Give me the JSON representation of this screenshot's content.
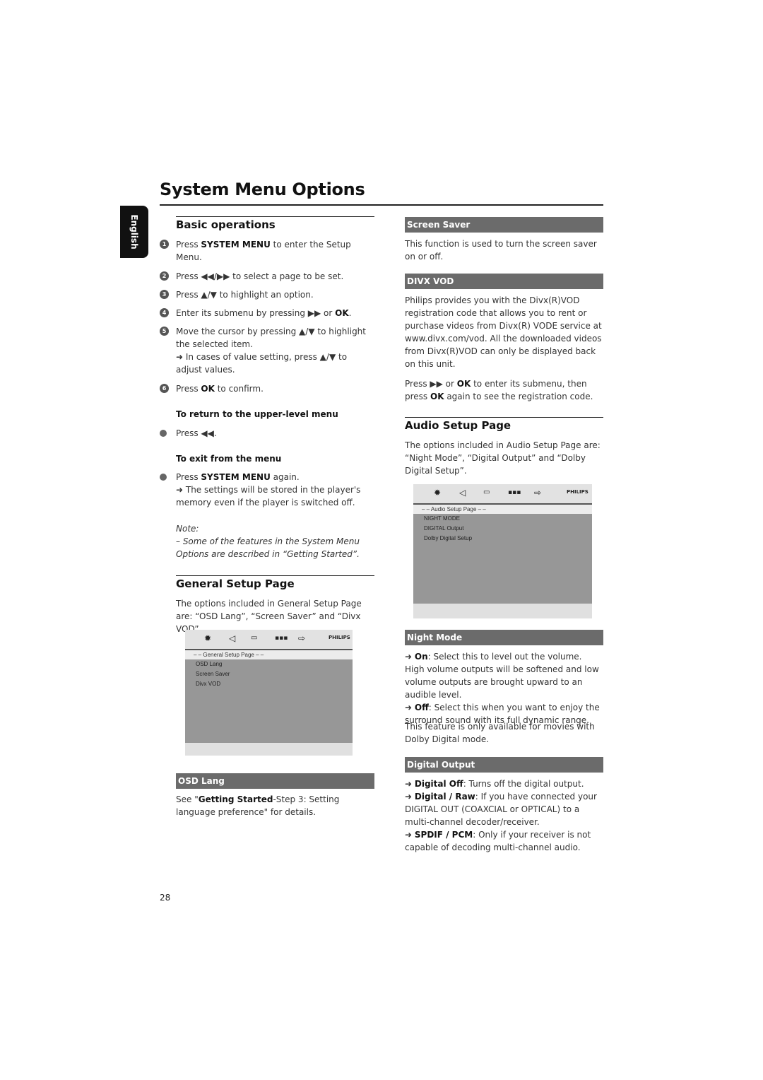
{
  "page": {
    "title": "System Menu Options",
    "language_tab": "English",
    "page_number": "28"
  },
  "basic": {
    "heading": "Basic operations",
    "steps": [
      {
        "num": "1",
        "pre": "Press ",
        "bold": "SYSTEM MENU",
        "post": " to enter the Setup Menu."
      },
      {
        "num": "2",
        "text": "Press ◀◀/▶▶ to select a page to be set."
      },
      {
        "num": "3",
        "text": "Press ▲/▼ to highlight an option."
      },
      {
        "num": "4",
        "pre": "Enter its submenu by pressing ▶▶ or ",
        "bold": "OK",
        "post": "."
      },
      {
        "num": "5",
        "text": "Move the cursor by pressing ▲/▼ to highlight the selected item.",
        "sub": "➜ In cases of value setting, press ▲/▼ to adjust values."
      },
      {
        "num": "6",
        "pre": "Press ",
        "bold": "OK",
        "post": " to confirm."
      }
    ],
    "return_heading": "To return to the upper-level menu",
    "return_text": "Press ◀◀.",
    "exit_heading": "To exit from the menu",
    "exit_pre": "Press ",
    "exit_bold": "SYSTEM MENU",
    "exit_post": " again.",
    "exit_sub": "➜ The settings will be stored in the player's memory even if the player is switched off.",
    "note_label": "Note:",
    "note_text": "–  Some of the features in the System Menu Options are described in “Getting Started”."
  },
  "general": {
    "heading": "General Setup Page",
    "intro": "The options included in General Setup Page are: “OSD Lang”, “Screen Saver” and “Divx VOD”.",
    "screen": {
      "icons": [
        "gear-icon",
        "speaker-icon",
        "display-icon",
        "grid-icon",
        "exit-icon"
      ],
      "brand": "PHILIPS",
      "header": "– –   General Setup Page   – –",
      "items": [
        "OSD Lang",
        "Screen Saver",
        "Divx VOD"
      ]
    },
    "osd_bar": "OSD Lang",
    "osd_pre": "See \"",
    "osd_bold": "Getting Started",
    "osd_post": "-Step 3: Setting language preference\" for details."
  },
  "screen_saver": {
    "bar": "Screen Saver",
    "text": "This function is used to turn the screen saver on or off."
  },
  "divx": {
    "bar": "DIVX VOD",
    "text": "Philips provides you with the Divx(R)VOD registration code that allows you to rent or purchase videos from Divx(R) VODE service at www.divx.com/vod. All the downloaded videos from Divx(R)VOD can only be displayed back on this unit.",
    "press_pre": "Press ▶▶ or ",
    "press_bold1": "OK",
    "press_mid": " to enter its submenu, then press ",
    "press_bold2": "OK",
    "press_post": " again to see the registration code."
  },
  "audio": {
    "heading": "Audio Setup Page",
    "intro": "The options included in Audio Setup Page are: “Night Mode”, “Digital Output” and  “Dolby Digital Setup”.",
    "screen": {
      "brand": "PHILIPS",
      "header": "– –   Audio Setup Page   – –",
      "items": [
        "NIGHT MODE",
        "DIGITAL Output",
        "Dolby Digital Setup"
      ]
    }
  },
  "night": {
    "bar": "Night Mode",
    "on_label": "On",
    "on_text": ": Select this to level out the volume. High volume outputs will be softened and low volume outputs are brought upward to an audible level.",
    "off_label": "Off",
    "off_text": ": Select this when you want to enjoy the surround sound with its full dynamic range.",
    "note": "This feature is only available for movies with Dolby Digital mode."
  },
  "digital": {
    "bar": "Digital Output",
    "items": [
      {
        "label": "Digital Off",
        "text": ": Turns off the digital output."
      },
      {
        "label": "Digital / Raw",
        "text": ":  If you have connected your DIGITAL OUT (COAXCIAL or OPTICAL) to a multi-channel decoder/receiver."
      },
      {
        "label": "SPDIF / PCM",
        "text": ": Only if your receiver is not capable of decoding multi-channel audio."
      }
    ]
  }
}
